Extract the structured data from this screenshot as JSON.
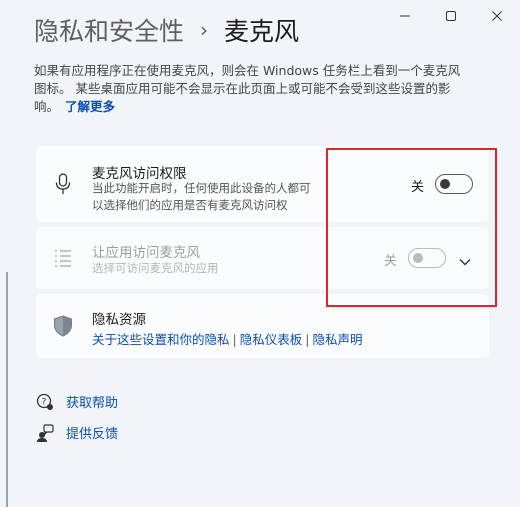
{
  "window": {
    "minimize_label": "—",
    "maximize_label": "□",
    "close_label": "✕"
  },
  "breadcrumb": {
    "parent": "隐私和安全性",
    "separator": "›",
    "current": "麦克风"
  },
  "description": {
    "line1": "如果有应用程序正在使用麦克风，则会在 Windows 任务栏上看到一个麦克风",
    "line2": "图标。 某些桌面应用可能不会显示在此页面上或可能不会受到这些设置的影",
    "line3": "响。",
    "link": "了解更多"
  },
  "mic_access": {
    "title": "麦克风访问权限",
    "subtitle_line1": "当此功能开启时，任何使用此设备的人都可",
    "subtitle_line2": "以选择他们的应用是否有麦克风访问权",
    "toggle_label": "关",
    "toggle_on": false,
    "icon": "microphone-icon"
  },
  "app_access": {
    "title": "让应用访问麦克风",
    "subtitle": "选择可访问麦克风的应用",
    "toggle_label": "关",
    "toggle_on": false,
    "disabled": true,
    "icon": "list-icon"
  },
  "privacy_resources": {
    "title": "隐私资源",
    "links": [
      "关于这些设置和你的隐私",
      "隐私仪表板",
      "隐私声明"
    ],
    "separator": "|",
    "icon": "shield-icon"
  },
  "footer": {
    "help": "获取帮助",
    "feedback": "提供反馈"
  },
  "colors": {
    "background": "#f1f4f9",
    "card": "#fbfcfe",
    "link": "#0a4fb3",
    "highlight": "#e1262b"
  }
}
